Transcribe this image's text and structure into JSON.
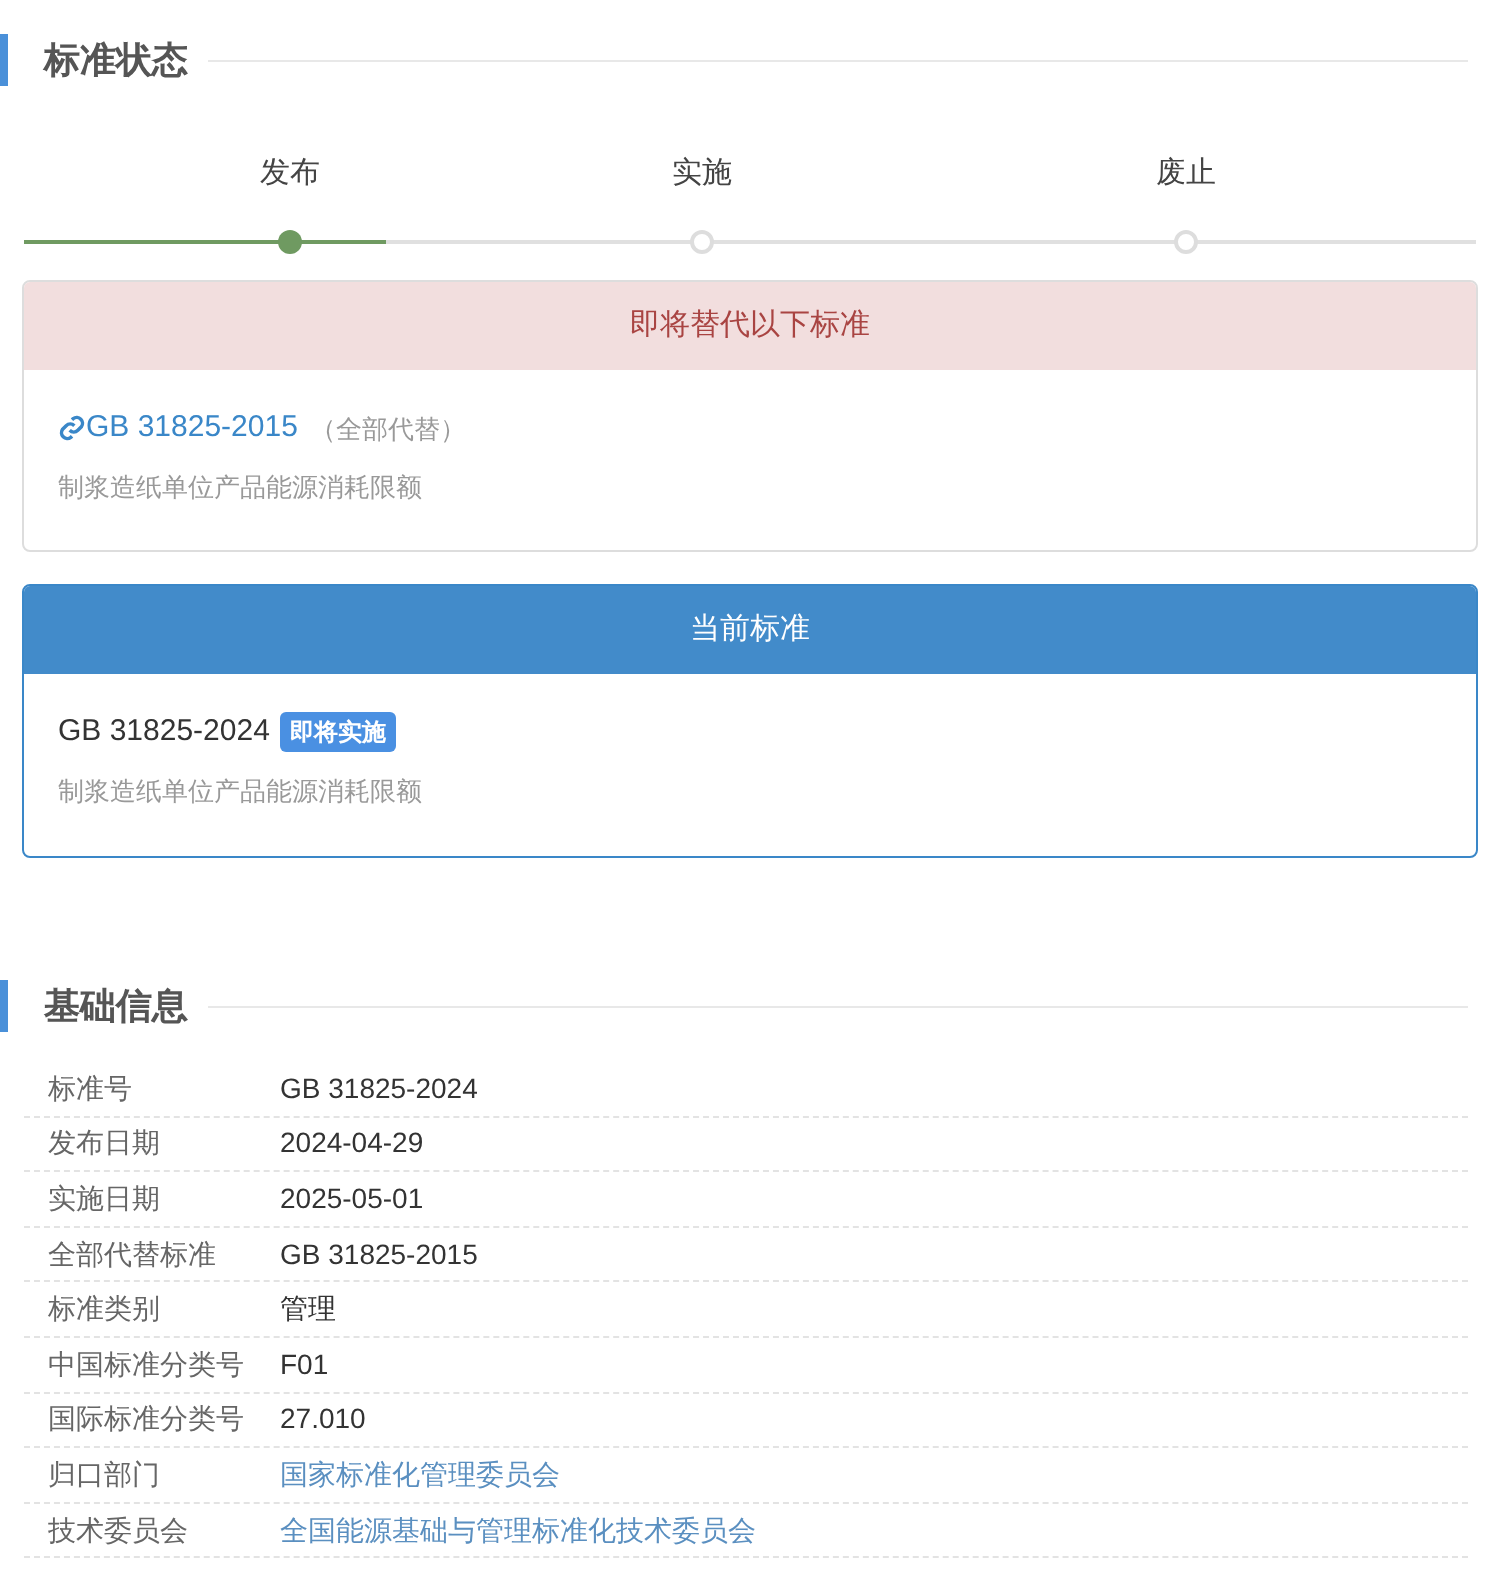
{
  "status_section": {
    "title": "标准状态",
    "steps": [
      {
        "label": "发布",
        "selected": true
      },
      {
        "label": "实施",
        "selected": false
      },
      {
        "label": "废止",
        "selected": false
      }
    ]
  },
  "replaced_card": {
    "header": "即将替代以下标准",
    "code": "GB 31825-2015",
    "note": "（全部代替）",
    "name": "制浆造纸单位产品能源消耗限额"
  },
  "current_card": {
    "header": "当前标准",
    "code": "GB 31825-2024",
    "badge": "即将实施",
    "name": "制浆造纸单位产品能源消耗限额"
  },
  "info_section": {
    "title": "基础信息",
    "rows": [
      {
        "label": "标准号",
        "value": "GB 31825-2024",
        "link": false
      },
      {
        "label": "发布日期",
        "value": "2024-04-29",
        "link": false
      },
      {
        "label": "实施日期",
        "value": "2025-05-01",
        "link": false
      },
      {
        "label": "全部代替标准",
        "value": "GB 31825-2015",
        "link": false
      },
      {
        "label": "标准类别",
        "value": "管理",
        "link": false
      },
      {
        "label": "中国标准分类号",
        "value": "F01",
        "link": false
      },
      {
        "label": "国际标准分类号",
        "value": "27.010",
        "link": false
      },
      {
        "label": "归口部门",
        "value": "国家标准化管理委员会",
        "link": true
      },
      {
        "label": "技术委员会",
        "value": "全国能源基础与管理标准化技术委员会",
        "link": true
      }
    ]
  }
}
